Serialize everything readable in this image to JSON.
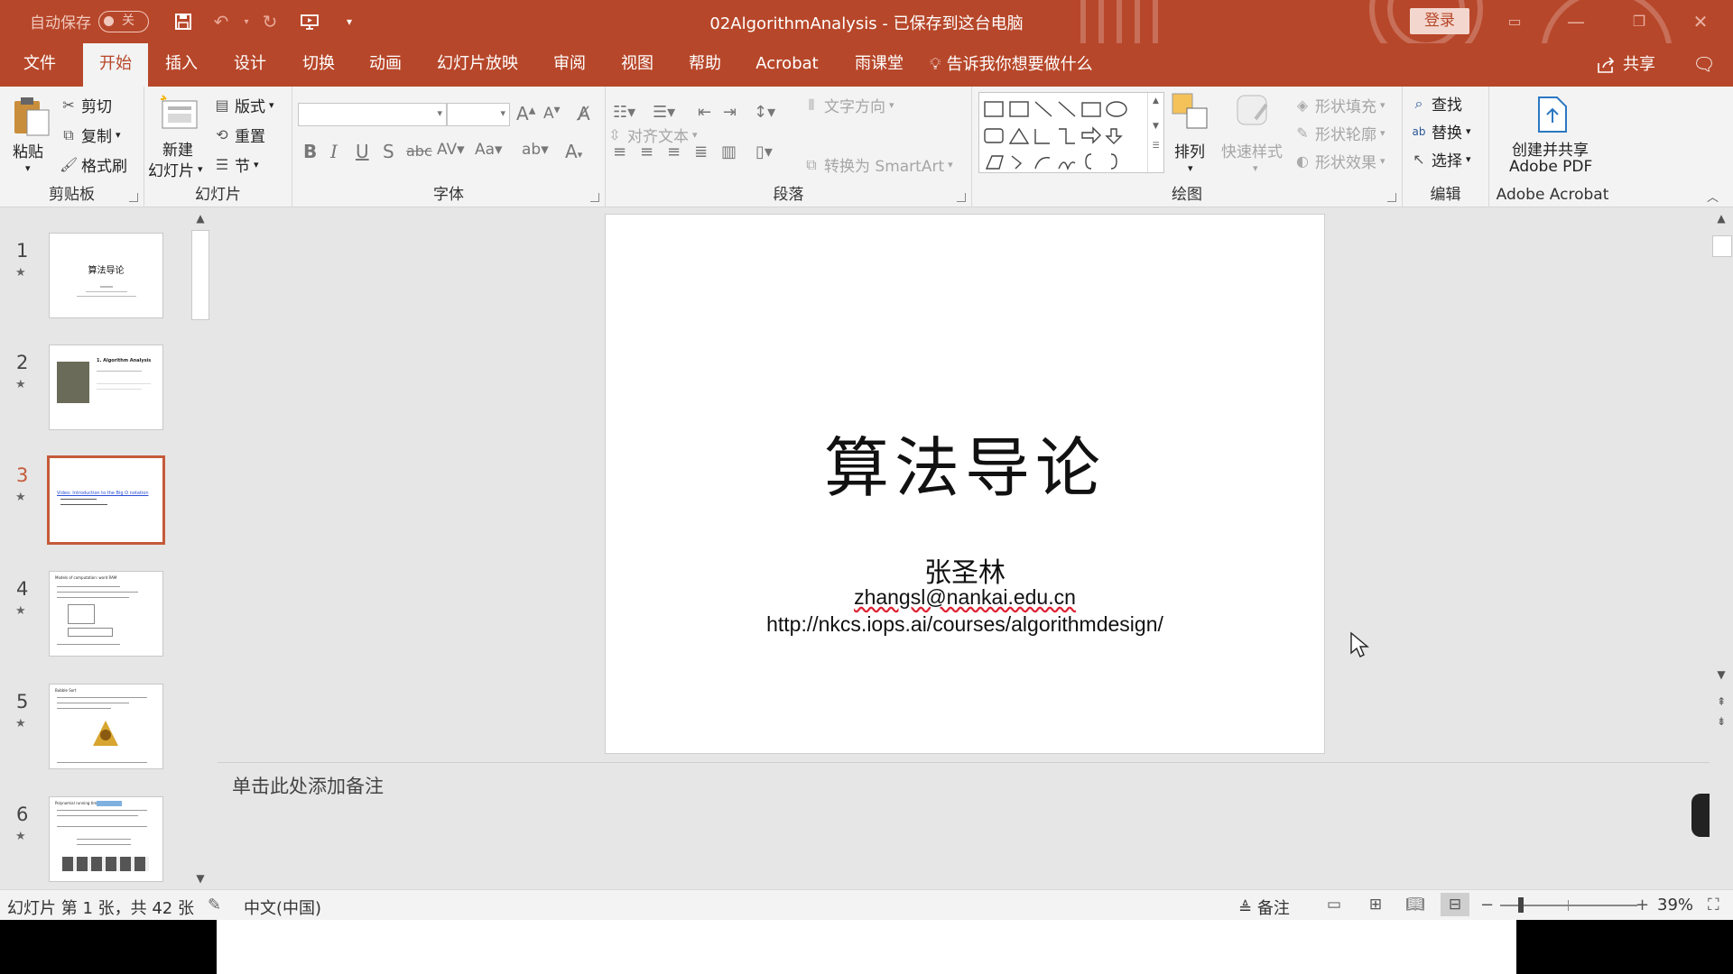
{
  "titlebar": {
    "autosave_label": "自动保存",
    "autosave_state": "关",
    "doc_title": "02AlgorithmAnalysis  -  已保存到这台电脑",
    "login": "登录"
  },
  "tabs": [
    "文件",
    "开始",
    "插入",
    "设计",
    "切换",
    "动画",
    "幻灯片放映",
    "审阅",
    "视图",
    "帮助",
    "Acrobat",
    "雨课堂"
  ],
  "tell_me": "告诉我你想要做什么",
  "share": "共享",
  "ribbon": {
    "clipboard": {
      "label": "剪贴板",
      "paste": "粘贴",
      "cut": "剪切",
      "copy": "复制",
      "format_painter": "格式刷"
    },
    "slides": {
      "label": "幻灯片",
      "new_slide_1": "新建",
      "new_slide_2": "幻灯片",
      "layout": "版式",
      "reset": "重置",
      "section": "节"
    },
    "font": {
      "label": "字体",
      "change_case": "Aa"
    },
    "paragraph": {
      "label": "段落",
      "text_direction": "文字方向",
      "align_text": "对齐文本",
      "smartart": "转换为 SmartArt"
    },
    "drawing": {
      "label": "绘图",
      "arrange": "排列",
      "quick_styles": "快速样式",
      "fill": "形状填充",
      "outline": "形状轮廓",
      "effects": "形状效果"
    },
    "editing": {
      "label": "编辑",
      "find": "查找",
      "replace": "替换",
      "select": "选择"
    },
    "acrobat": {
      "label": "Adobe Acrobat",
      "create_1": "创建并共享",
      "create_2": "Adobe PDF"
    }
  },
  "thumbnails": [
    {
      "num": "1",
      "title": "算法导论",
      "selected": false
    },
    {
      "num": "2",
      "title": "1. Algorithm Analysis",
      "selected": false
    },
    {
      "num": "3",
      "title": "Video: Introduction to the Big O notation",
      "selected": true
    },
    {
      "num": "4",
      "title": "Models of computation: word RAM",
      "selected": false
    },
    {
      "num": "5",
      "title": "Bubble Sort",
      "selected": false
    },
    {
      "num": "6",
      "title": "Polynomial running time",
      "selected": false
    }
  ],
  "slide": {
    "title": "算法导论",
    "author": "张圣林",
    "email": "zhangsl@nankai.edu.cn",
    "url": "http://nkcs.iops.ai/courses/algorithmdesign/"
  },
  "notes_placeholder": "单击此处添加备注",
  "status": {
    "slide_info": "幻灯片 第 1 张，共 42 张",
    "language": "中文(中国)",
    "notes": "备注",
    "zoom": "39%"
  },
  "colors": {
    "accent": "#b7472a",
    "selected_thumb": "#c55a3a"
  }
}
